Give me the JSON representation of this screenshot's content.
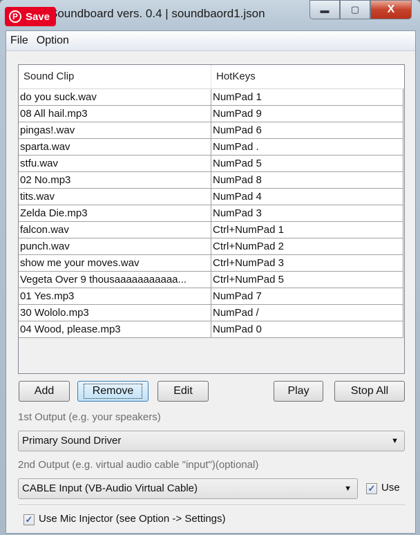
{
  "window": {
    "title": "Soundboard vers. 0.4 | soundbaord1.json",
    "controls": {
      "minimize": "▬",
      "maximize": "▢",
      "close": "X"
    }
  },
  "overlay": {
    "pin_label": "Save",
    "pin_icon": "P"
  },
  "menu": {
    "items": [
      "File",
      "Option"
    ]
  },
  "table": {
    "columns": [
      "Sound Clip",
      "HotKeys"
    ],
    "rows": [
      [
        "do you suck.wav",
        "NumPad 1"
      ],
      [
        "08 All hail.mp3",
        "NumPad 9"
      ],
      [
        "pingas!.wav",
        "NumPad 6"
      ],
      [
        "sparta.wav",
        "NumPad ."
      ],
      [
        "stfu.wav",
        "NumPad 5"
      ],
      [
        "02 No.mp3",
        "NumPad 8"
      ],
      [
        "tits.wav",
        "NumPad 4"
      ],
      [
        "Zelda  Die.mp3",
        "NumPad 3"
      ],
      [
        "falcon.wav",
        "Ctrl+NumPad 1"
      ],
      [
        "punch.wav",
        "Ctrl+NumPad 2"
      ],
      [
        "show me your moves.wav",
        "Ctrl+NumPad 3"
      ],
      [
        "Vegeta  Over 9 thousaaaaaaaaaaa...",
        "Ctrl+NumPad 5"
      ],
      [
        "01 Yes.mp3",
        "NumPad 7"
      ],
      [
        "30 Wololo.mp3",
        "NumPad /"
      ],
      [
        "04 Wood, please.mp3",
        "NumPad 0"
      ]
    ]
  },
  "buttons": {
    "add": "Add",
    "remove": "Remove",
    "edit": "Edit",
    "play": "Play",
    "stop_all": "Stop All"
  },
  "output1": {
    "label": "1st Output (e.g. your speakers)",
    "value": "Primary Sound Driver"
  },
  "output2": {
    "label": "2nd Output (e.g. virtual audio cable \"input\")(optional)",
    "value": "CABLE Input (VB-Audio Virtual Cable)",
    "use_label": "Use",
    "use_checked": true
  },
  "mic_injector": {
    "label": "Use Mic Injector (see Option -> Settings)",
    "checked": true
  },
  "check_glyph": "✓",
  "dropdown_glyph": "▼"
}
